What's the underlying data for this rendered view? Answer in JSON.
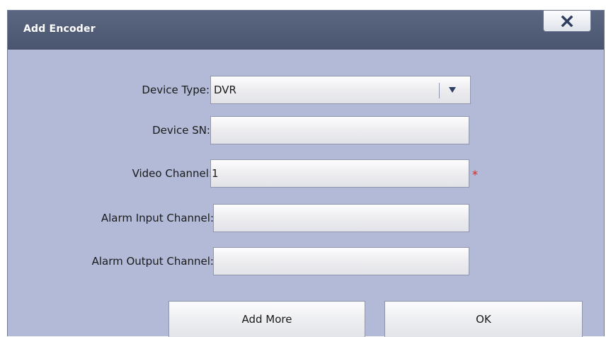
{
  "dialog": {
    "title": "Add Encoder",
    "close_icon": "close-x-icon"
  },
  "form": {
    "device_type": {
      "label": "Device Type:",
      "value": "DVR"
    },
    "device_sn": {
      "label": "Device SN:",
      "value": ""
    },
    "video_channel": {
      "label": "Video Channel:",
      "value": "1",
      "required_mark": "*"
    },
    "alarm_input_channel": {
      "label": "Alarm Input Channel:",
      "value": ""
    },
    "alarm_output_channel": {
      "label": "Alarm Output Channel:",
      "value": ""
    }
  },
  "buttons": {
    "add_more": "Add More",
    "ok": "OK"
  },
  "colors": {
    "dialog_background": "#b2bad7",
    "titlebar": "#4f5b75",
    "required": "#e02020"
  }
}
